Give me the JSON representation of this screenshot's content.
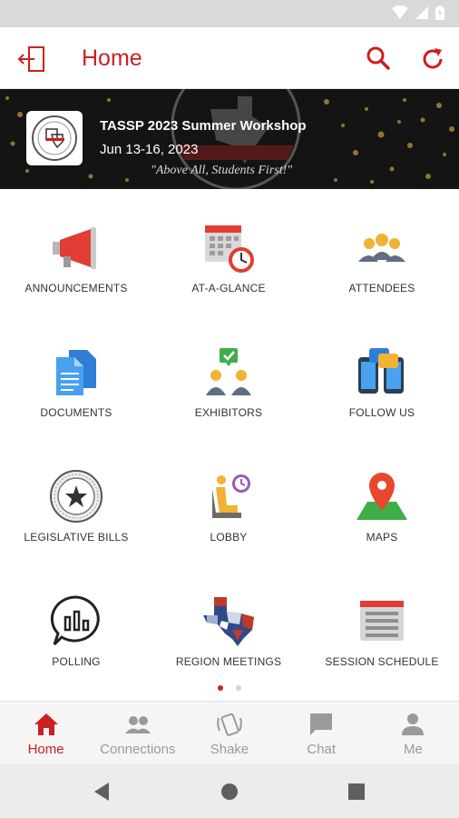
{
  "app": {
    "title": "Home"
  },
  "colors": {
    "accent": "#cc1f1f",
    "inactive": "#9a9a9a"
  },
  "banner": {
    "event_name": "TASSP 2023 Summer Workshop",
    "event_dates": "Jun 13-16, 2023",
    "tagline": "\"Above All, Students First!\""
  },
  "tiles": [
    {
      "label": "ANNOUNCEMENTS",
      "icon": "megaphone-icon"
    },
    {
      "label": "AT-A-GLANCE",
      "icon": "calendar-clock-icon"
    },
    {
      "label": "ATTENDEES",
      "icon": "people-group-icon"
    },
    {
      "label": "DOCUMENTS",
      "icon": "documents-icon"
    },
    {
      "label": "EXHIBITORS",
      "icon": "exhibitors-icon"
    },
    {
      "label": "FOLLOW US",
      "icon": "phones-chat-icon"
    },
    {
      "label": "LEGISLATIVE BILLS",
      "icon": "state-seal-icon"
    },
    {
      "label": "LOBBY",
      "icon": "lobby-chair-icon"
    },
    {
      "label": "MAPS",
      "icon": "map-pin-icon"
    },
    {
      "label": "POLLING",
      "icon": "poll-bubble-icon"
    },
    {
      "label": "REGION MEETINGS",
      "icon": "texas-map-icon"
    },
    {
      "label": "SESSION SCHEDULE",
      "icon": "schedule-list-icon"
    }
  ],
  "pager": {
    "pages": 2,
    "current": 1
  },
  "bottom_nav": [
    {
      "label": "Home",
      "icon": "home-icon",
      "active": true
    },
    {
      "label": "Connections",
      "icon": "connections-icon",
      "active": false
    },
    {
      "label": "Shake",
      "icon": "shake-icon",
      "active": false
    },
    {
      "label": "Chat",
      "icon": "chat-icon",
      "active": false
    },
    {
      "label": "Me",
      "icon": "person-icon",
      "active": false
    }
  ]
}
